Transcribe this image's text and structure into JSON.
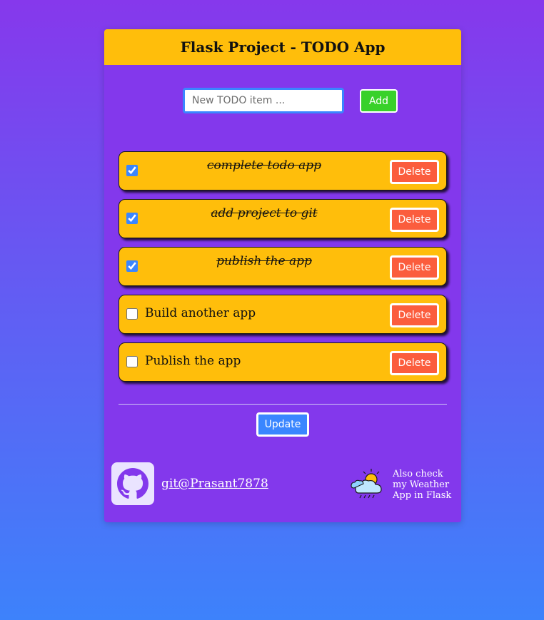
{
  "header": {
    "title": "Flask Project - TODO App"
  },
  "add_form": {
    "placeholder": "New TODO item ...",
    "value": "",
    "add_label": "Add"
  },
  "todos": [
    {
      "text": "complete todo app",
      "done": true,
      "delete_label": "Delete"
    },
    {
      "text": "add project to git",
      "done": true,
      "delete_label": "Delete"
    },
    {
      "text": "publish the app",
      "done": true,
      "delete_label": "Delete"
    },
    {
      "text": "Build another app",
      "done": false,
      "delete_label": "Delete"
    },
    {
      "text": "Publish the app",
      "done": false,
      "delete_label": "Delete"
    }
  ],
  "update_label": "Update",
  "footer": {
    "github_icon": "github-icon",
    "github_link": "git@Prasant7878",
    "weather_icon": "weather-cloud-sun-rain-icon",
    "weather_text": "Also check my Weather App in Flask"
  },
  "colors": {
    "background_top": "#8638ec",
    "background_bottom": "#3d82fb",
    "card": "#8338ec",
    "accent_yellow": "#ffbe0b",
    "delete_red": "#fb5d3d",
    "add_green": "#38d12a",
    "update_blue": "#3a86ff"
  }
}
